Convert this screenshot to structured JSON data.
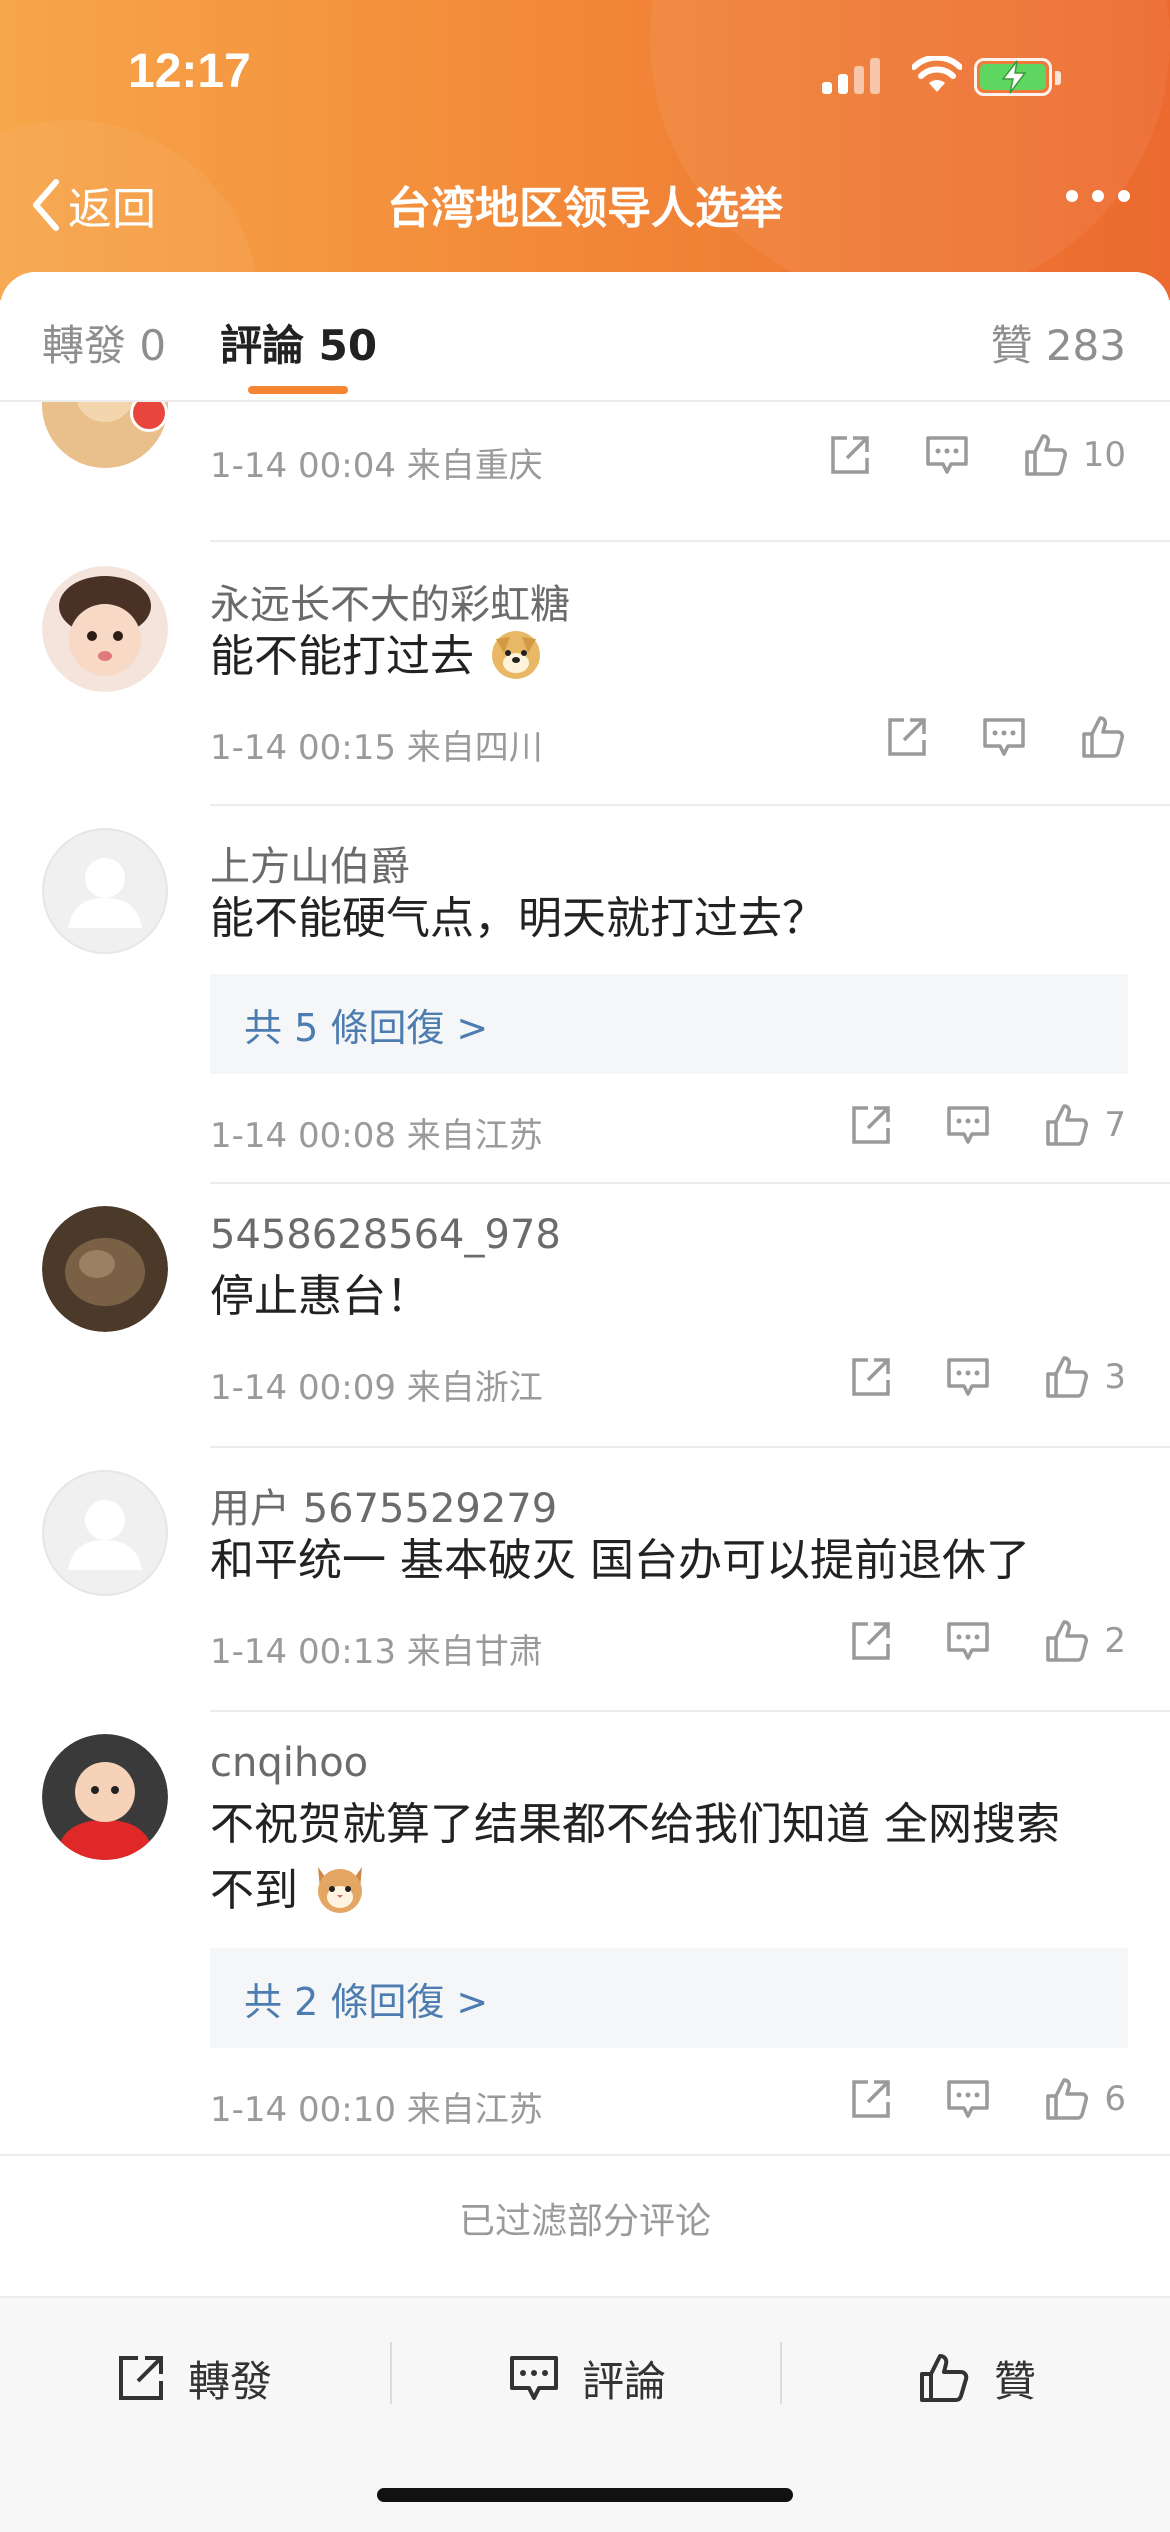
{
  "status_bar": {
    "time": "12:17"
  },
  "nav": {
    "back_label": "返回",
    "title": "台湾地区领导人选举"
  },
  "tabs": {
    "repost": "轉發 0",
    "comment": "評論 50",
    "like": "贊 283"
  },
  "comments": [
    {
      "name": "",
      "text": "",
      "meta": "1-14 00:04  来自重庆",
      "likes": "10",
      "replies": ""
    },
    {
      "name": "永远长不大的彩虹糖",
      "text": "能不能打过去",
      "emoji": "doge-emoji",
      "meta": "1-14 00:15  来自四川",
      "likes": "",
      "replies": ""
    },
    {
      "name": "上方山伯爵",
      "text": "能不能硬气点，明天就打过去？",
      "meta": "1-14 00:08  来自江苏",
      "likes": "7",
      "replies": "共 5 條回復 >"
    },
    {
      "name": "5458628564_978",
      "text": "停止惠台！",
      "meta": "1-14 00:09  来自浙江",
      "likes": "3",
      "replies": ""
    },
    {
      "name": "用户 5675529279",
      "text": "和平统一 基本破灭 国台办可以提前退休了",
      "meta": "1-14 00:13  来自甘肃",
      "likes": "2",
      "replies": ""
    },
    {
      "name": "cnqihoo",
      "text_line1": "不祝贺就算了结果都不给我们知道 全网搜索",
      "text_line2": "不到",
      "emoji": "cat-emoji",
      "meta": "1-14 00:10  来自江苏",
      "likes": "6",
      "replies": "共 2 條回復 >"
    }
  ],
  "filtered_note": "已过滤部分评论",
  "bottom_bar": {
    "repost": "轉發",
    "comment": "評論",
    "like": "贊"
  },
  "colors": {
    "header_start": "#f7a64a",
    "header_end": "#ec6a2f",
    "accent": "#f58533",
    "link": "#4d7cb0"
  }
}
